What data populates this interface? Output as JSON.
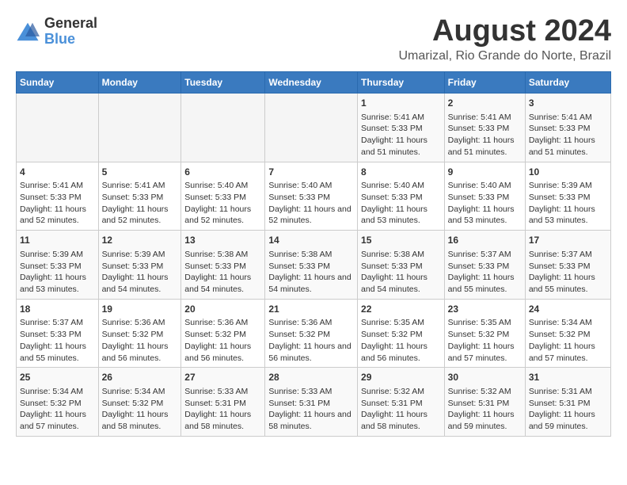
{
  "logo": {
    "general": "General",
    "blue": "Blue"
  },
  "title": {
    "month_year": "August 2024",
    "location": "Umarizal, Rio Grande do Norte, Brazil"
  },
  "headers": [
    "Sunday",
    "Monday",
    "Tuesday",
    "Wednesday",
    "Thursday",
    "Friday",
    "Saturday"
  ],
  "weeks": [
    [
      {
        "day": "",
        "sunrise": "",
        "sunset": "",
        "daylight": ""
      },
      {
        "day": "",
        "sunrise": "",
        "sunset": "",
        "daylight": ""
      },
      {
        "day": "",
        "sunrise": "",
        "sunset": "",
        "daylight": ""
      },
      {
        "day": "",
        "sunrise": "",
        "sunset": "",
        "daylight": ""
      },
      {
        "day": "1",
        "sunrise": "Sunrise: 5:41 AM",
        "sunset": "Sunset: 5:33 PM",
        "daylight": "Daylight: 11 hours and 51 minutes."
      },
      {
        "day": "2",
        "sunrise": "Sunrise: 5:41 AM",
        "sunset": "Sunset: 5:33 PM",
        "daylight": "Daylight: 11 hours and 51 minutes."
      },
      {
        "day": "3",
        "sunrise": "Sunrise: 5:41 AM",
        "sunset": "Sunset: 5:33 PM",
        "daylight": "Daylight: 11 hours and 51 minutes."
      }
    ],
    [
      {
        "day": "4",
        "sunrise": "Sunrise: 5:41 AM",
        "sunset": "Sunset: 5:33 PM",
        "daylight": "Daylight: 11 hours and 52 minutes."
      },
      {
        "day": "5",
        "sunrise": "Sunrise: 5:41 AM",
        "sunset": "Sunset: 5:33 PM",
        "daylight": "Daylight: 11 hours and 52 minutes."
      },
      {
        "day": "6",
        "sunrise": "Sunrise: 5:40 AM",
        "sunset": "Sunset: 5:33 PM",
        "daylight": "Daylight: 11 hours and 52 minutes."
      },
      {
        "day": "7",
        "sunrise": "Sunrise: 5:40 AM",
        "sunset": "Sunset: 5:33 PM",
        "daylight": "Daylight: 11 hours and 52 minutes."
      },
      {
        "day": "8",
        "sunrise": "Sunrise: 5:40 AM",
        "sunset": "Sunset: 5:33 PM",
        "daylight": "Daylight: 11 hours and 53 minutes."
      },
      {
        "day": "9",
        "sunrise": "Sunrise: 5:40 AM",
        "sunset": "Sunset: 5:33 PM",
        "daylight": "Daylight: 11 hours and 53 minutes."
      },
      {
        "day": "10",
        "sunrise": "Sunrise: 5:39 AM",
        "sunset": "Sunset: 5:33 PM",
        "daylight": "Daylight: 11 hours and 53 minutes."
      }
    ],
    [
      {
        "day": "11",
        "sunrise": "Sunrise: 5:39 AM",
        "sunset": "Sunset: 5:33 PM",
        "daylight": "Daylight: 11 hours and 53 minutes."
      },
      {
        "day": "12",
        "sunrise": "Sunrise: 5:39 AM",
        "sunset": "Sunset: 5:33 PM",
        "daylight": "Daylight: 11 hours and 54 minutes."
      },
      {
        "day": "13",
        "sunrise": "Sunrise: 5:38 AM",
        "sunset": "Sunset: 5:33 PM",
        "daylight": "Daylight: 11 hours and 54 minutes."
      },
      {
        "day": "14",
        "sunrise": "Sunrise: 5:38 AM",
        "sunset": "Sunset: 5:33 PM",
        "daylight": "Daylight: 11 hours and 54 minutes."
      },
      {
        "day": "15",
        "sunrise": "Sunrise: 5:38 AM",
        "sunset": "Sunset: 5:33 PM",
        "daylight": "Daylight: 11 hours and 54 minutes."
      },
      {
        "day": "16",
        "sunrise": "Sunrise: 5:37 AM",
        "sunset": "Sunset: 5:33 PM",
        "daylight": "Daylight: 11 hours and 55 minutes."
      },
      {
        "day": "17",
        "sunrise": "Sunrise: 5:37 AM",
        "sunset": "Sunset: 5:33 PM",
        "daylight": "Daylight: 11 hours and 55 minutes."
      }
    ],
    [
      {
        "day": "18",
        "sunrise": "Sunrise: 5:37 AM",
        "sunset": "Sunset: 5:33 PM",
        "daylight": "Daylight: 11 hours and 55 minutes."
      },
      {
        "day": "19",
        "sunrise": "Sunrise: 5:36 AM",
        "sunset": "Sunset: 5:32 PM",
        "daylight": "Daylight: 11 hours and 56 minutes."
      },
      {
        "day": "20",
        "sunrise": "Sunrise: 5:36 AM",
        "sunset": "Sunset: 5:32 PM",
        "daylight": "Daylight: 11 hours and 56 minutes."
      },
      {
        "day": "21",
        "sunrise": "Sunrise: 5:36 AM",
        "sunset": "Sunset: 5:32 PM",
        "daylight": "Daylight: 11 hours and 56 minutes."
      },
      {
        "day": "22",
        "sunrise": "Sunrise: 5:35 AM",
        "sunset": "Sunset: 5:32 PM",
        "daylight": "Daylight: 11 hours and 56 minutes."
      },
      {
        "day": "23",
        "sunrise": "Sunrise: 5:35 AM",
        "sunset": "Sunset: 5:32 PM",
        "daylight": "Daylight: 11 hours and 57 minutes."
      },
      {
        "day": "24",
        "sunrise": "Sunrise: 5:34 AM",
        "sunset": "Sunset: 5:32 PM",
        "daylight": "Daylight: 11 hours and 57 minutes."
      }
    ],
    [
      {
        "day": "25",
        "sunrise": "Sunrise: 5:34 AM",
        "sunset": "Sunset: 5:32 PM",
        "daylight": "Daylight: 11 hours and 57 minutes."
      },
      {
        "day": "26",
        "sunrise": "Sunrise: 5:34 AM",
        "sunset": "Sunset: 5:32 PM",
        "daylight": "Daylight: 11 hours and 58 minutes."
      },
      {
        "day": "27",
        "sunrise": "Sunrise: 5:33 AM",
        "sunset": "Sunset: 5:31 PM",
        "daylight": "Daylight: 11 hours and 58 minutes."
      },
      {
        "day": "28",
        "sunrise": "Sunrise: 5:33 AM",
        "sunset": "Sunset: 5:31 PM",
        "daylight": "Daylight: 11 hours and 58 minutes."
      },
      {
        "day": "29",
        "sunrise": "Sunrise: 5:32 AM",
        "sunset": "Sunset: 5:31 PM",
        "daylight": "Daylight: 11 hours and 58 minutes."
      },
      {
        "day": "30",
        "sunrise": "Sunrise: 5:32 AM",
        "sunset": "Sunset: 5:31 PM",
        "daylight": "Daylight: 11 hours and 59 minutes."
      },
      {
        "day": "31",
        "sunrise": "Sunrise: 5:31 AM",
        "sunset": "Sunset: 5:31 PM",
        "daylight": "Daylight: 11 hours and 59 minutes."
      }
    ]
  ]
}
